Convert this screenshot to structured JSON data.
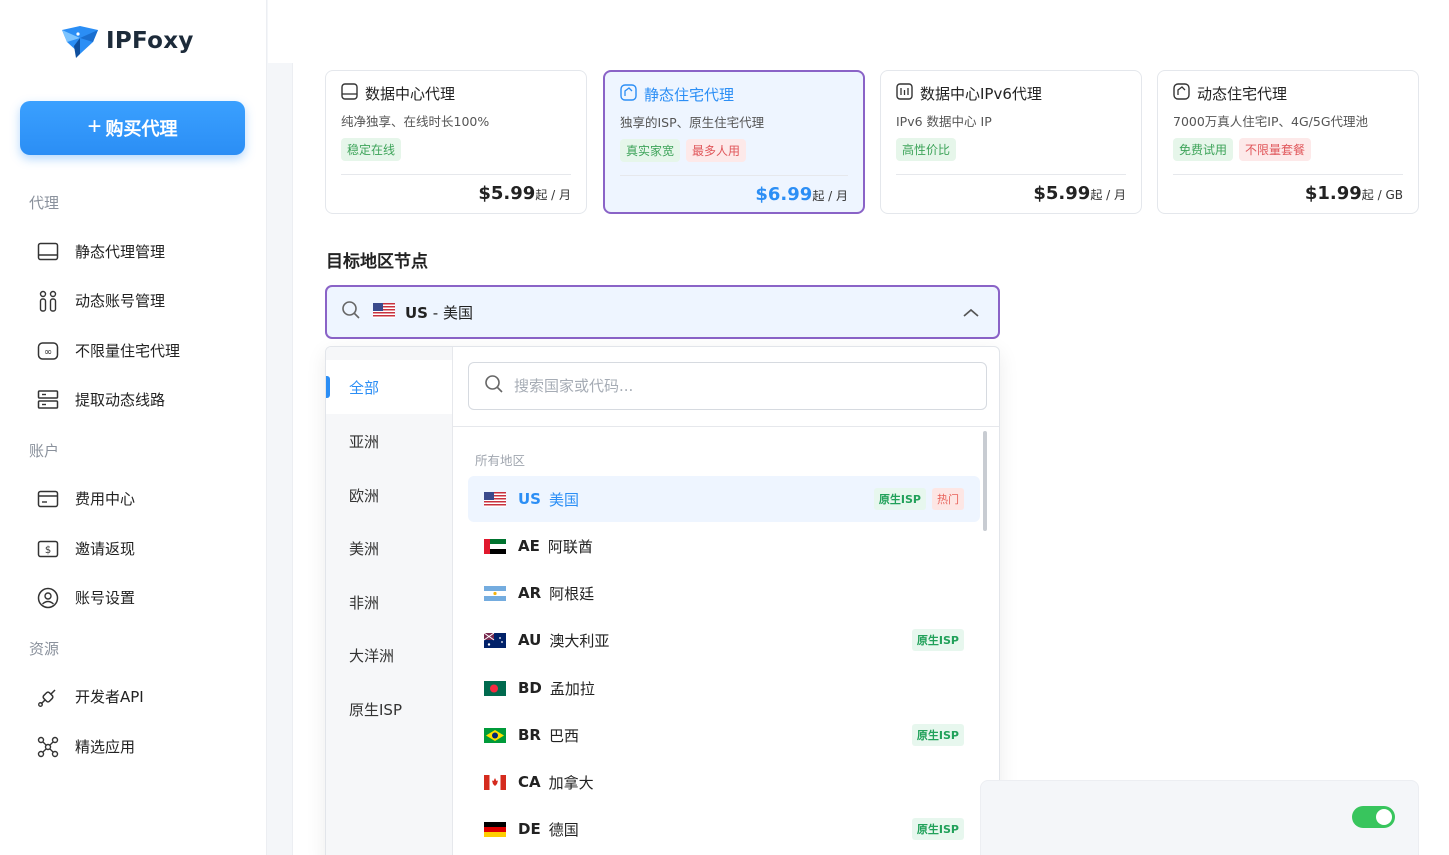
{
  "app": {
    "logo_text": "IPFoxy"
  },
  "sidebar": {
    "buy_button": "购买代理",
    "sections": [
      {
        "title": "代理",
        "items": [
          {
            "label": "静态代理管理",
            "icon": "monitor-icon"
          },
          {
            "label": "动态账号管理",
            "icon": "people-icon"
          },
          {
            "label": "不限量住宅代理",
            "icon": "infinity-icon"
          },
          {
            "label": "提取动态线路",
            "icon": "server-icon"
          }
        ]
      },
      {
        "title": "账户",
        "items": [
          {
            "label": "费用中心",
            "icon": "card-icon"
          },
          {
            "label": "邀请返现",
            "icon": "cash-icon"
          },
          {
            "label": "账号设置",
            "icon": "user-icon"
          }
        ]
      },
      {
        "title": "资源",
        "items": [
          {
            "label": "开发者API",
            "icon": "api-icon"
          },
          {
            "label": "精选应用",
            "icon": "apps-icon"
          }
        ]
      }
    ]
  },
  "products": [
    {
      "title": "数据中心代理",
      "desc": "纯净独享、在线时长100%",
      "tags": [
        {
          "text": "稳定在线",
          "color": "green"
        }
      ],
      "price": "$5.99",
      "unit": "起 / 月",
      "icon": "datacenter-icon",
      "active": false
    },
    {
      "title": "静态住宅代理",
      "desc": "独享的ISP、原生住宅代理",
      "tags": [
        {
          "text": "真实家宽",
          "color": "green"
        },
        {
          "text": "最多人用",
          "color": "red"
        }
      ],
      "price": "$6.99",
      "unit": "起 / 月",
      "icon": "residential-icon",
      "active": true
    },
    {
      "title": "数据中心IPv6代理",
      "desc": "IPv6 数据中心 IP",
      "tags": [
        {
          "text": "高性价比",
          "color": "green"
        }
      ],
      "price": "$5.99",
      "unit": "起 / 月",
      "icon": "ipv6-icon",
      "active": false
    },
    {
      "title": "动态住宅代理",
      "desc": "7000万真人住宅IP、4G/5G代理池",
      "tags": [
        {
          "text": "免费试用",
          "color": "green"
        },
        {
          "text": "不限量套餐",
          "color": "red"
        }
      ],
      "price": "$1.99",
      "unit": "起 / GB",
      "icon": "dynamic-icon",
      "active": false
    }
  ],
  "region": {
    "label": "目标地区节点",
    "selected_code": "US",
    "selected_name": "- 美国",
    "search_placeholder": "搜索国家或代码...",
    "categories": [
      "全部",
      "亚洲",
      "欧洲",
      "美洲",
      "非洲",
      "大洋洲",
      "原生ISP"
    ],
    "active_category": 0,
    "list_caption": "所有地区",
    "countries": [
      {
        "code": "US",
        "name": "美国",
        "flag": "us",
        "badges": [
          "原生ISP",
          "热门"
        ],
        "active": true
      },
      {
        "code": "AE",
        "name": "阿联酋",
        "flag": "ae",
        "badges": []
      },
      {
        "code": "AR",
        "name": "阿根廷",
        "flag": "ar",
        "badges": []
      },
      {
        "code": "AU",
        "name": "澳大利亚",
        "flag": "au",
        "badges": [
          "原生ISP"
        ]
      },
      {
        "code": "BD",
        "name": "孟加拉",
        "flag": "bd",
        "badges": []
      },
      {
        "code": "BR",
        "name": "巴西",
        "flag": "br",
        "badges": [
          "原生ISP"
        ]
      },
      {
        "code": "CA",
        "name": "加拿大",
        "flag": "ca",
        "badges": []
      },
      {
        "code": "DE",
        "name": "德国",
        "flag": "de",
        "badges": [
          "原生ISP"
        ]
      }
    ]
  },
  "colors": {
    "accent": "#2b8ef5",
    "active_border": "#8a63c7",
    "toggle_on": "#38c55d"
  }
}
